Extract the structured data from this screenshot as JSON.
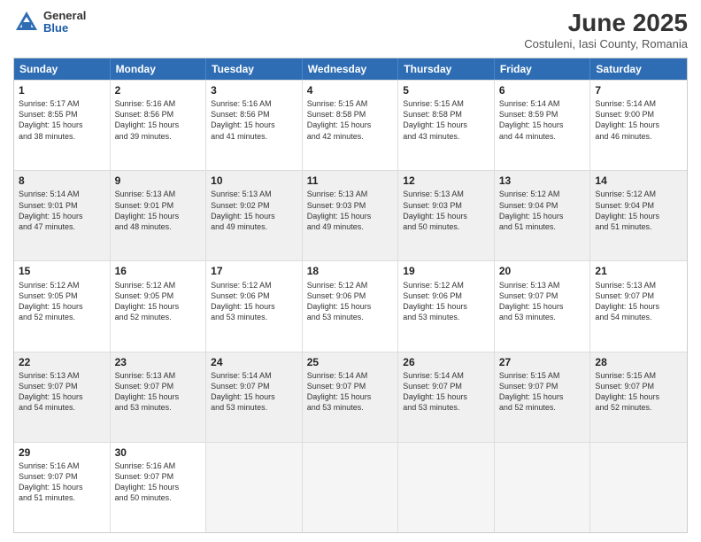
{
  "header": {
    "logo": {
      "general": "General",
      "blue": "Blue"
    },
    "title": "June 2025",
    "location": "Costuleni, Iasi County, Romania"
  },
  "weekdays": [
    "Sunday",
    "Monday",
    "Tuesday",
    "Wednesday",
    "Thursday",
    "Friday",
    "Saturday"
  ],
  "rows": [
    [
      {
        "day": "1",
        "lines": [
          "Sunrise: 5:17 AM",
          "Sunset: 8:55 PM",
          "Daylight: 15 hours",
          "and 38 minutes."
        ],
        "shade": false
      },
      {
        "day": "2",
        "lines": [
          "Sunrise: 5:16 AM",
          "Sunset: 8:56 PM",
          "Daylight: 15 hours",
          "and 39 minutes."
        ],
        "shade": false
      },
      {
        "day": "3",
        "lines": [
          "Sunrise: 5:16 AM",
          "Sunset: 8:56 PM",
          "Daylight: 15 hours",
          "and 41 minutes."
        ],
        "shade": false
      },
      {
        "day": "4",
        "lines": [
          "Sunrise: 5:15 AM",
          "Sunset: 8:58 PM",
          "Daylight: 15 hours",
          "and 42 minutes."
        ],
        "shade": false
      },
      {
        "day": "5",
        "lines": [
          "Sunrise: 5:15 AM",
          "Sunset: 8:58 PM",
          "Daylight: 15 hours",
          "and 43 minutes."
        ],
        "shade": false
      },
      {
        "day": "6",
        "lines": [
          "Sunrise: 5:14 AM",
          "Sunset: 8:59 PM",
          "Daylight: 15 hours",
          "and 44 minutes."
        ],
        "shade": false
      },
      {
        "day": "7",
        "lines": [
          "Sunrise: 5:14 AM",
          "Sunset: 9:00 PM",
          "Daylight: 15 hours",
          "and 46 minutes."
        ],
        "shade": false
      }
    ],
    [
      {
        "day": "8",
        "lines": [
          "Sunrise: 5:14 AM",
          "Sunset: 9:01 PM",
          "Daylight: 15 hours",
          "and 47 minutes."
        ],
        "shade": true
      },
      {
        "day": "9",
        "lines": [
          "Sunrise: 5:13 AM",
          "Sunset: 9:01 PM",
          "Daylight: 15 hours",
          "and 48 minutes."
        ],
        "shade": true
      },
      {
        "day": "10",
        "lines": [
          "Sunrise: 5:13 AM",
          "Sunset: 9:02 PM",
          "Daylight: 15 hours",
          "and 49 minutes."
        ],
        "shade": true
      },
      {
        "day": "11",
        "lines": [
          "Sunrise: 5:13 AM",
          "Sunset: 9:03 PM",
          "Daylight: 15 hours",
          "and 49 minutes."
        ],
        "shade": true
      },
      {
        "day": "12",
        "lines": [
          "Sunrise: 5:13 AM",
          "Sunset: 9:03 PM",
          "Daylight: 15 hours",
          "and 50 minutes."
        ],
        "shade": true
      },
      {
        "day": "13",
        "lines": [
          "Sunrise: 5:12 AM",
          "Sunset: 9:04 PM",
          "Daylight: 15 hours",
          "and 51 minutes."
        ],
        "shade": true
      },
      {
        "day": "14",
        "lines": [
          "Sunrise: 5:12 AM",
          "Sunset: 9:04 PM",
          "Daylight: 15 hours",
          "and 51 minutes."
        ],
        "shade": true
      }
    ],
    [
      {
        "day": "15",
        "lines": [
          "Sunrise: 5:12 AM",
          "Sunset: 9:05 PM",
          "Daylight: 15 hours",
          "and 52 minutes."
        ],
        "shade": false
      },
      {
        "day": "16",
        "lines": [
          "Sunrise: 5:12 AM",
          "Sunset: 9:05 PM",
          "Daylight: 15 hours",
          "and 52 minutes."
        ],
        "shade": false
      },
      {
        "day": "17",
        "lines": [
          "Sunrise: 5:12 AM",
          "Sunset: 9:06 PM",
          "Daylight: 15 hours",
          "and 53 minutes."
        ],
        "shade": false
      },
      {
        "day": "18",
        "lines": [
          "Sunrise: 5:12 AM",
          "Sunset: 9:06 PM",
          "Daylight: 15 hours",
          "and 53 minutes."
        ],
        "shade": false
      },
      {
        "day": "19",
        "lines": [
          "Sunrise: 5:12 AM",
          "Sunset: 9:06 PM",
          "Daylight: 15 hours",
          "and 53 minutes."
        ],
        "shade": false
      },
      {
        "day": "20",
        "lines": [
          "Sunrise: 5:13 AM",
          "Sunset: 9:07 PM",
          "Daylight: 15 hours",
          "and 53 minutes."
        ],
        "shade": false
      },
      {
        "day": "21",
        "lines": [
          "Sunrise: 5:13 AM",
          "Sunset: 9:07 PM",
          "Daylight: 15 hours",
          "and 54 minutes."
        ],
        "shade": false
      }
    ],
    [
      {
        "day": "22",
        "lines": [
          "Sunrise: 5:13 AM",
          "Sunset: 9:07 PM",
          "Daylight: 15 hours",
          "and 54 minutes."
        ],
        "shade": true
      },
      {
        "day": "23",
        "lines": [
          "Sunrise: 5:13 AM",
          "Sunset: 9:07 PM",
          "Daylight: 15 hours",
          "and 53 minutes."
        ],
        "shade": true
      },
      {
        "day": "24",
        "lines": [
          "Sunrise: 5:14 AM",
          "Sunset: 9:07 PM",
          "Daylight: 15 hours",
          "and 53 minutes."
        ],
        "shade": true
      },
      {
        "day": "25",
        "lines": [
          "Sunrise: 5:14 AM",
          "Sunset: 9:07 PM",
          "Daylight: 15 hours",
          "and 53 minutes."
        ],
        "shade": true
      },
      {
        "day": "26",
        "lines": [
          "Sunrise: 5:14 AM",
          "Sunset: 9:07 PM",
          "Daylight: 15 hours",
          "and 53 minutes."
        ],
        "shade": true
      },
      {
        "day": "27",
        "lines": [
          "Sunrise: 5:15 AM",
          "Sunset: 9:07 PM",
          "Daylight: 15 hours",
          "and 52 minutes."
        ],
        "shade": true
      },
      {
        "day": "28",
        "lines": [
          "Sunrise: 5:15 AM",
          "Sunset: 9:07 PM",
          "Daylight: 15 hours",
          "and 52 minutes."
        ],
        "shade": true
      }
    ],
    [
      {
        "day": "29",
        "lines": [
          "Sunrise: 5:16 AM",
          "Sunset: 9:07 PM",
          "Daylight: 15 hours",
          "and 51 minutes."
        ],
        "shade": false
      },
      {
        "day": "30",
        "lines": [
          "Sunrise: 5:16 AM",
          "Sunset: 9:07 PM",
          "Daylight: 15 hours",
          "and 50 minutes."
        ],
        "shade": false
      },
      {
        "day": "",
        "lines": [],
        "shade": true,
        "empty": true
      },
      {
        "day": "",
        "lines": [],
        "shade": true,
        "empty": true
      },
      {
        "day": "",
        "lines": [],
        "shade": true,
        "empty": true
      },
      {
        "day": "",
        "lines": [],
        "shade": true,
        "empty": true
      },
      {
        "day": "",
        "lines": [],
        "shade": true,
        "empty": true
      }
    ]
  ]
}
